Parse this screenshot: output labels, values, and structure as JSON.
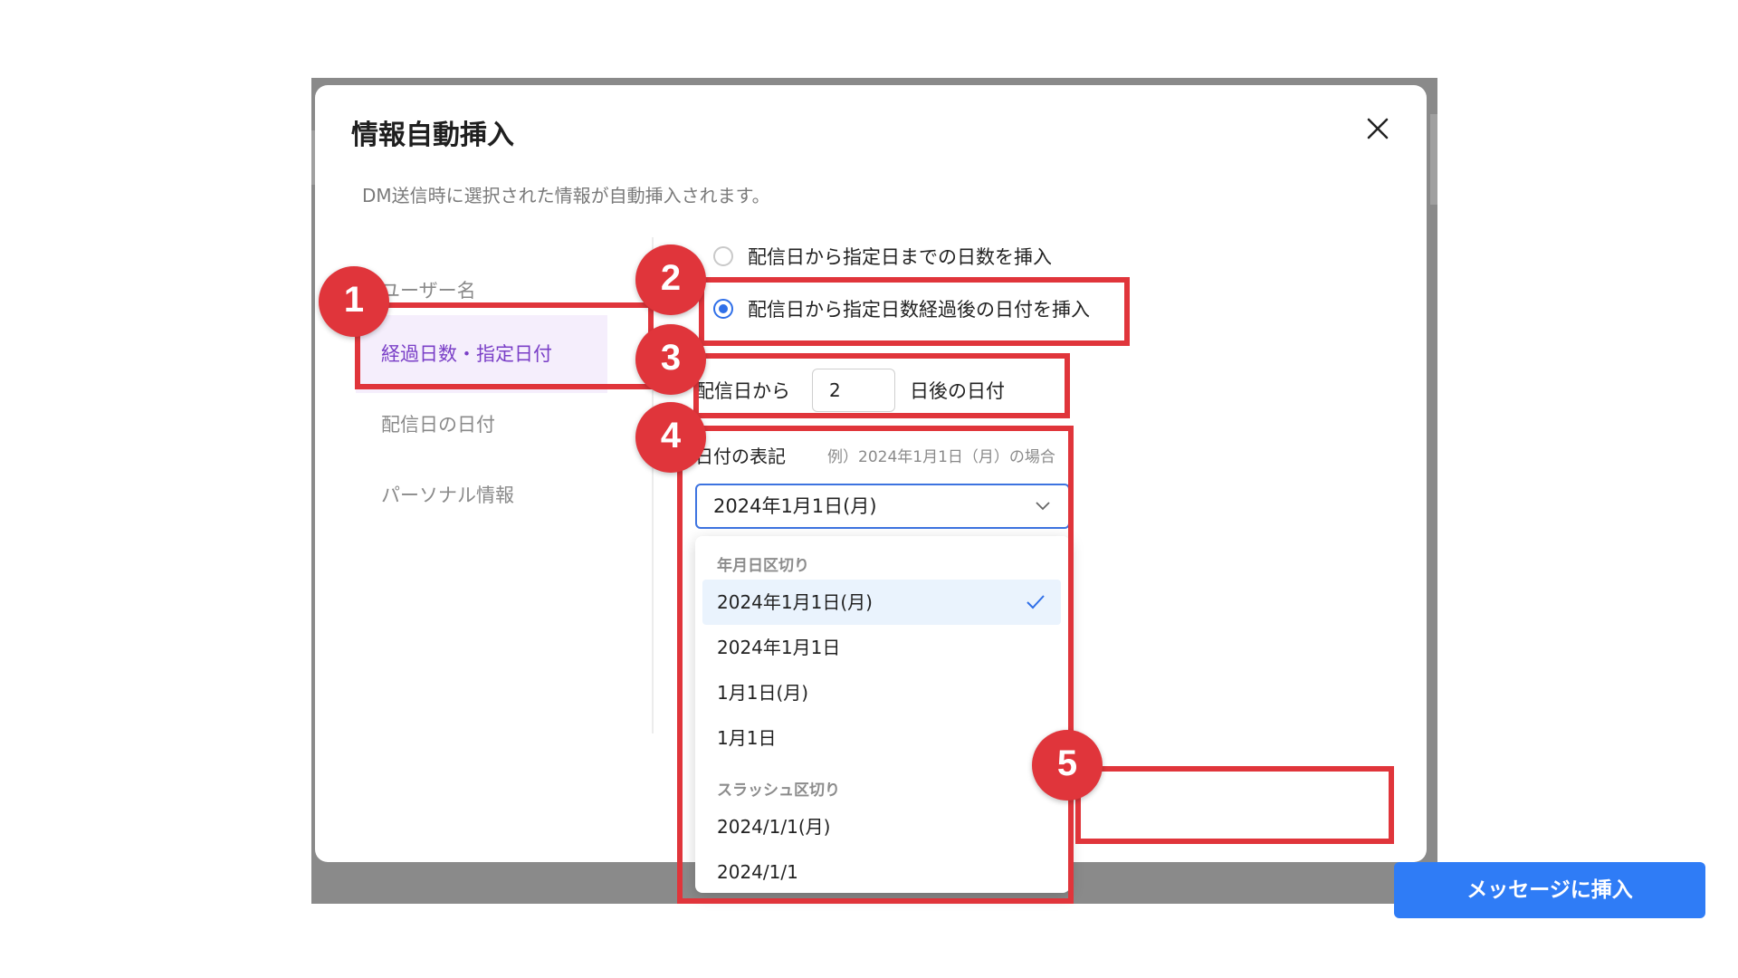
{
  "modal": {
    "title": "情報自動挿入",
    "description": "DM送信時に選択された情報が自動挿入されます。"
  },
  "sidebar": {
    "items": [
      {
        "label": "ユーザー名",
        "active": false
      },
      {
        "label": "経過日数・指定日付",
        "active": true
      },
      {
        "label": "配信日の日付",
        "active": false
      },
      {
        "label": "パーソナル情報",
        "active": false
      }
    ]
  },
  "options": {
    "radio1": {
      "label": "配信日から指定日までの日数を挿入",
      "checked": false
    },
    "radio2": {
      "label": "配信日から指定日数経過後の日付を挿入",
      "checked": true
    }
  },
  "days": {
    "prefix": "配信日から",
    "value": "2",
    "suffix": "日後の日付"
  },
  "format": {
    "label": "日付の表記",
    "example": "例）2024年1月1日（月）の場合",
    "selected": "2024年1月1日(月)",
    "groups": [
      {
        "label": "年月日区切り",
        "items": [
          "2024年1月1日(月)",
          "2024年1月1日",
          "1月1日(月)",
          "1月1日"
        ]
      },
      {
        "label": "スラッシュ区切り",
        "items": [
          "2024/1/1(月)",
          "2024/1/1"
        ]
      }
    ]
  },
  "actions": {
    "insert_label": "メッセージに挿入"
  },
  "annotations": {
    "badges": [
      "1",
      "2",
      "3",
      "4",
      "5"
    ],
    "color": "#e0353b"
  },
  "colors": {
    "accent": "#2f7cf6",
    "sidebar_active_text": "#7a3fc7",
    "sidebar_active_bg": "#f5eefc",
    "dropdown_selected_bg": "#eaf3fd"
  }
}
